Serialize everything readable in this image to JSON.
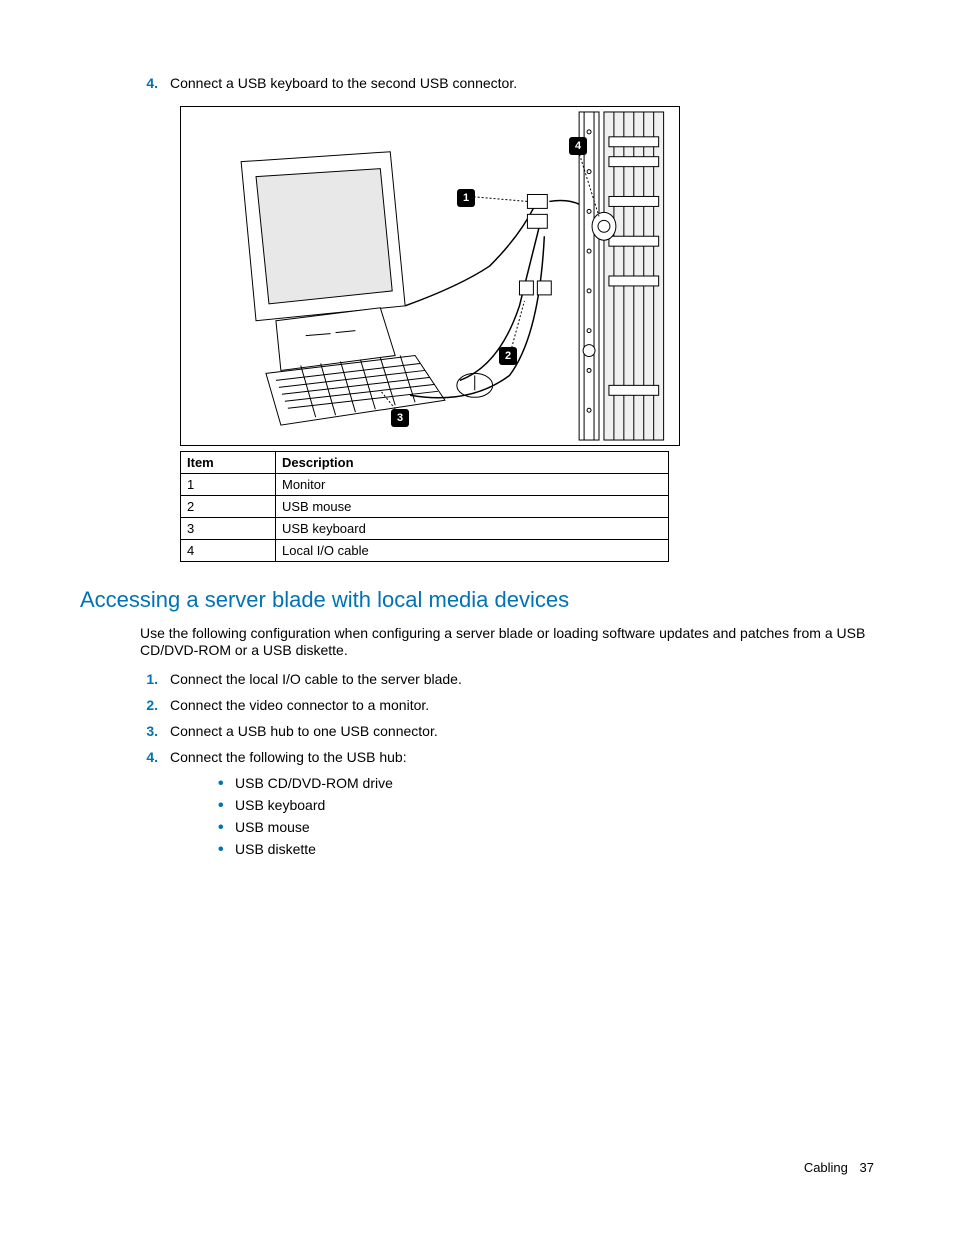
{
  "topStep": {
    "number": "4.",
    "text": "Connect a USB keyboard to the second USB connector."
  },
  "callouts": [
    "1",
    "2",
    "3",
    "4"
  ],
  "table": {
    "headers": [
      "Item",
      "Description"
    ],
    "rows": [
      [
        "1",
        "Monitor"
      ],
      [
        "2",
        "USB mouse"
      ],
      [
        "3",
        "USB keyboard"
      ],
      [
        "4",
        "Local I/O cable"
      ]
    ]
  },
  "section": {
    "heading": "Accessing a server blade with local media devices",
    "intro": "Use the following configuration when configuring a server blade or loading software updates and patches from a USB CD/DVD-ROM or a USB diskette.",
    "steps": [
      {
        "number": "1.",
        "text": "Connect the local I/O cable to the server blade."
      },
      {
        "number": "2.",
        "text": "Connect the video connector to a monitor."
      },
      {
        "number": "3.",
        "text": "Connect a USB hub to one USB connector."
      },
      {
        "number": "4.",
        "text": "Connect the following to the USB hub:"
      }
    ],
    "sublist": [
      "USB CD/DVD-ROM drive",
      "USB keyboard",
      "USB mouse",
      "USB diskette"
    ]
  },
  "footer": {
    "section": "Cabling",
    "page": "37"
  }
}
